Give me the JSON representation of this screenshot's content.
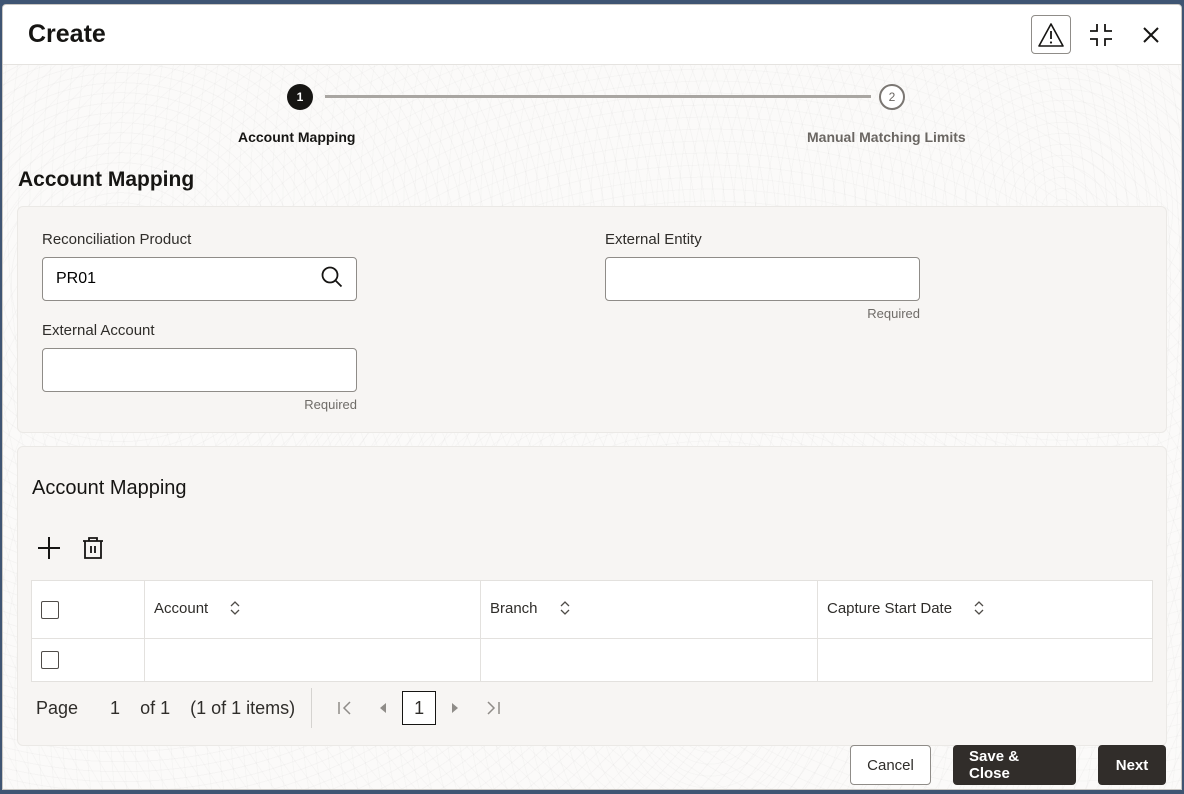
{
  "dialog": {
    "title": "Create",
    "header_icons": [
      "warning-icon",
      "collapse-icon",
      "close-icon"
    ]
  },
  "train": {
    "steps": [
      {
        "number": "1",
        "label": "Account Mapping",
        "state": "active"
      },
      {
        "number": "2",
        "label": "Manual Matching Limits",
        "state": "inactive"
      }
    ]
  },
  "form": {
    "section_title": "Account Mapping",
    "reconciliation_product": {
      "label": "Reconciliation Product",
      "value": "PR01",
      "icon": "search-icon"
    },
    "external_entity": {
      "label": "External Entity",
      "value": "",
      "helper": "Required"
    },
    "external_account": {
      "label": "External Account",
      "value": "",
      "helper": "Required"
    }
  },
  "grid": {
    "title": "Account Mapping",
    "toolbar": [
      "add-icon",
      "delete-icon"
    ],
    "columns": [
      "Account",
      "Branch",
      "Capture Start Date"
    ],
    "rows": [
      {
        "account": "",
        "branch": "",
        "capture_start_date": ""
      }
    ],
    "pager": {
      "page_label": "Page",
      "page_value": "1",
      "of_label": "of 1",
      "items_label": "(1 of 1 items)",
      "current_page": "1"
    }
  },
  "footer": {
    "cancel": "Cancel",
    "save_close": "Save & Close",
    "next": "Next"
  }
}
